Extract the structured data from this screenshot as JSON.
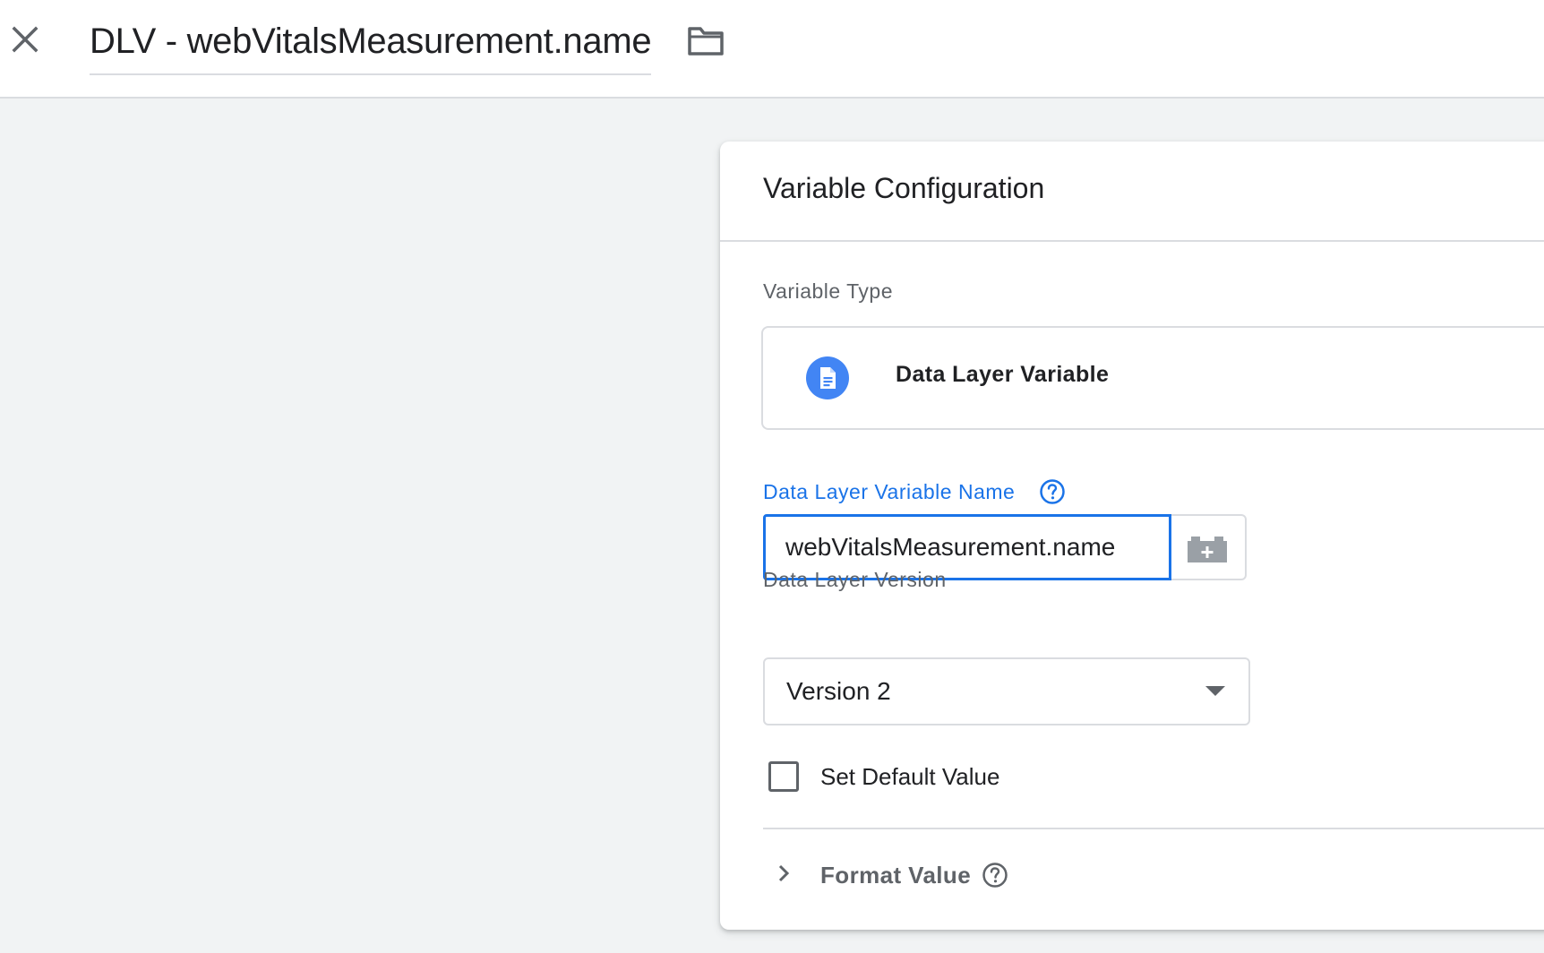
{
  "header": {
    "title": "DLV - webVitalsMeasurement.name",
    "close_icon": "close-icon",
    "folder_icon": "folder-icon"
  },
  "card": {
    "title": "Variable Configuration",
    "variable_type": {
      "label": "Variable Type",
      "name": "Data Layer Variable",
      "icon": "document-icon",
      "icon_color": "#4285f4"
    },
    "dlv_name": {
      "label": "Data Layer Variable Name",
      "value": "webVitalsMeasurement.name",
      "help_icon": "help-icon",
      "picker_icon": "variable-picker-icon"
    },
    "dlv_version": {
      "label": "Data Layer Version",
      "selected": "Version 2"
    },
    "default_value": {
      "label": "Set Default Value",
      "checked": false
    },
    "format_value": {
      "label": "Format Value",
      "expanded": false
    }
  },
  "colors": {
    "accent": "#1a73e8",
    "text_primary": "#202124",
    "text_secondary": "#5f6368",
    "border": "#dadce0",
    "background": "#f1f3f4"
  }
}
